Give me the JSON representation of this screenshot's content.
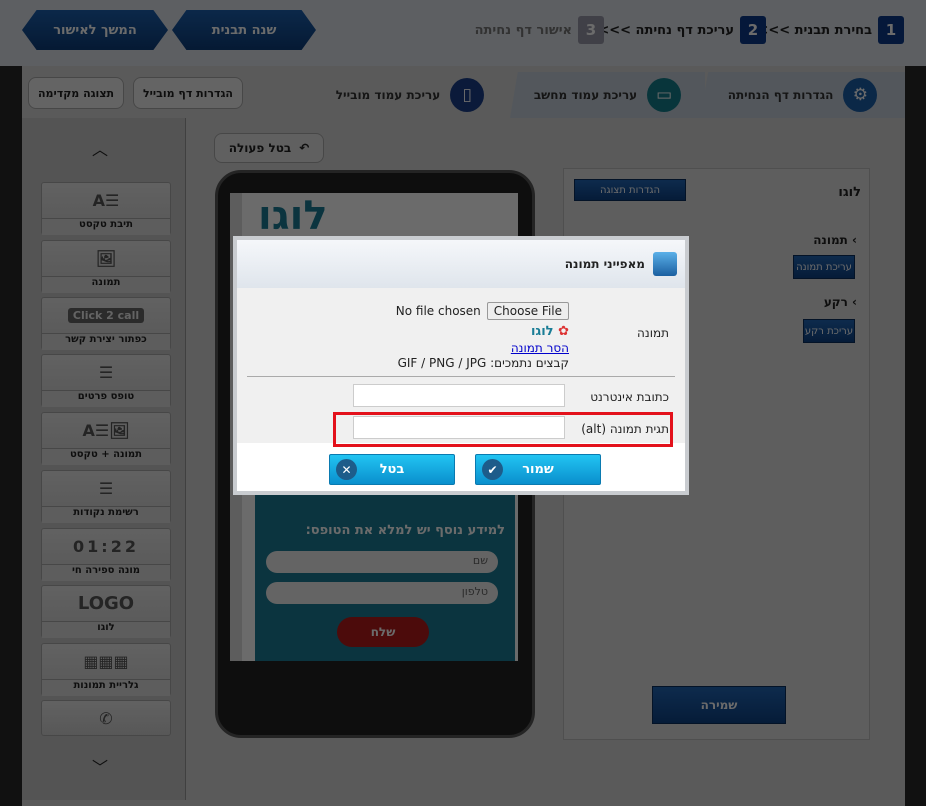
{
  "topbar": {
    "steps": [
      {
        "num": "1",
        "label": "בחירת תבנית >>>"
      },
      {
        "num": "2",
        "label": "עריכת דף נחיתה >>>"
      },
      {
        "num": "3",
        "label": "אישור דף נחיתה"
      }
    ],
    "change_template": "שנה תבנית",
    "continue": "המשך לאישור"
  },
  "tabs": [
    {
      "label": "הגדרות דף הנחיתה",
      "icon": "gear-icon"
    },
    {
      "label": "עריכת עמוד מחשב",
      "icon": "monitor-icon"
    },
    {
      "label": "עריכת עמוד מובייל",
      "icon": "mobile-icon"
    }
  ],
  "mobile_settings": "הגדרות דף מובייל",
  "preview": "תצוגה מקדימה",
  "sidebar": {
    "items": [
      {
        "label": "תיבת טקסט",
        "icon": "text-box-icon"
      },
      {
        "label": "תמונה",
        "icon": "image-icon"
      },
      {
        "label": "כפתור יצירת קשר",
        "icon": "click2call-icon",
        "icon_text": "Click 2 call"
      },
      {
        "label": "טופס פרטים",
        "icon": "form-icon"
      },
      {
        "label": "תמונה + טקסט",
        "icon": "image-text-icon"
      },
      {
        "label": "רשימת נקודות",
        "icon": "bullet-list-icon"
      },
      {
        "label": "מונה ספירה חי",
        "icon": "counter-icon",
        "icon_text": "01:22"
      },
      {
        "label": "לוגו",
        "icon": "logo-icon",
        "icon_text": "LOGO"
      },
      {
        "label": "גלריית תמונות",
        "icon": "gallery-icon"
      },
      {
        "label": "",
        "icon": "whatsapp-icon"
      }
    ]
  },
  "undo": "בטל פעולה",
  "phone": {
    "logo_text": "לוגו",
    "form_title": "למידע נוסף יש למלא את הטופס:",
    "name_placeholder": "שם",
    "phone_placeholder": "טלפון",
    "send": "שלח"
  },
  "right_panel": {
    "title": "לוגו",
    "display_settings": "הגדרות תצוגה",
    "image_label": "תמונה",
    "edit_image": "עריכת תמונה",
    "bg_label": "רקע",
    "edit_bg": "עריכת רקע",
    "save": "שמירה"
  },
  "dialog": {
    "title": "מאפייני תמונה",
    "image_label": "תמונה",
    "choose_file": "Choose File",
    "no_file": "No file chosen",
    "logo_preview_text": "לוגו",
    "remove_image": "הסר תמונה",
    "supported": "קבצים נתמכים: GIF / PNG / JPG",
    "url_label": "כתובת אינטרנט",
    "url_value": "",
    "alt_label": "תגית תמונה (alt)",
    "alt_value": "",
    "save": "שמור",
    "cancel": "בטל",
    "highlight_color": "#e3111b"
  }
}
